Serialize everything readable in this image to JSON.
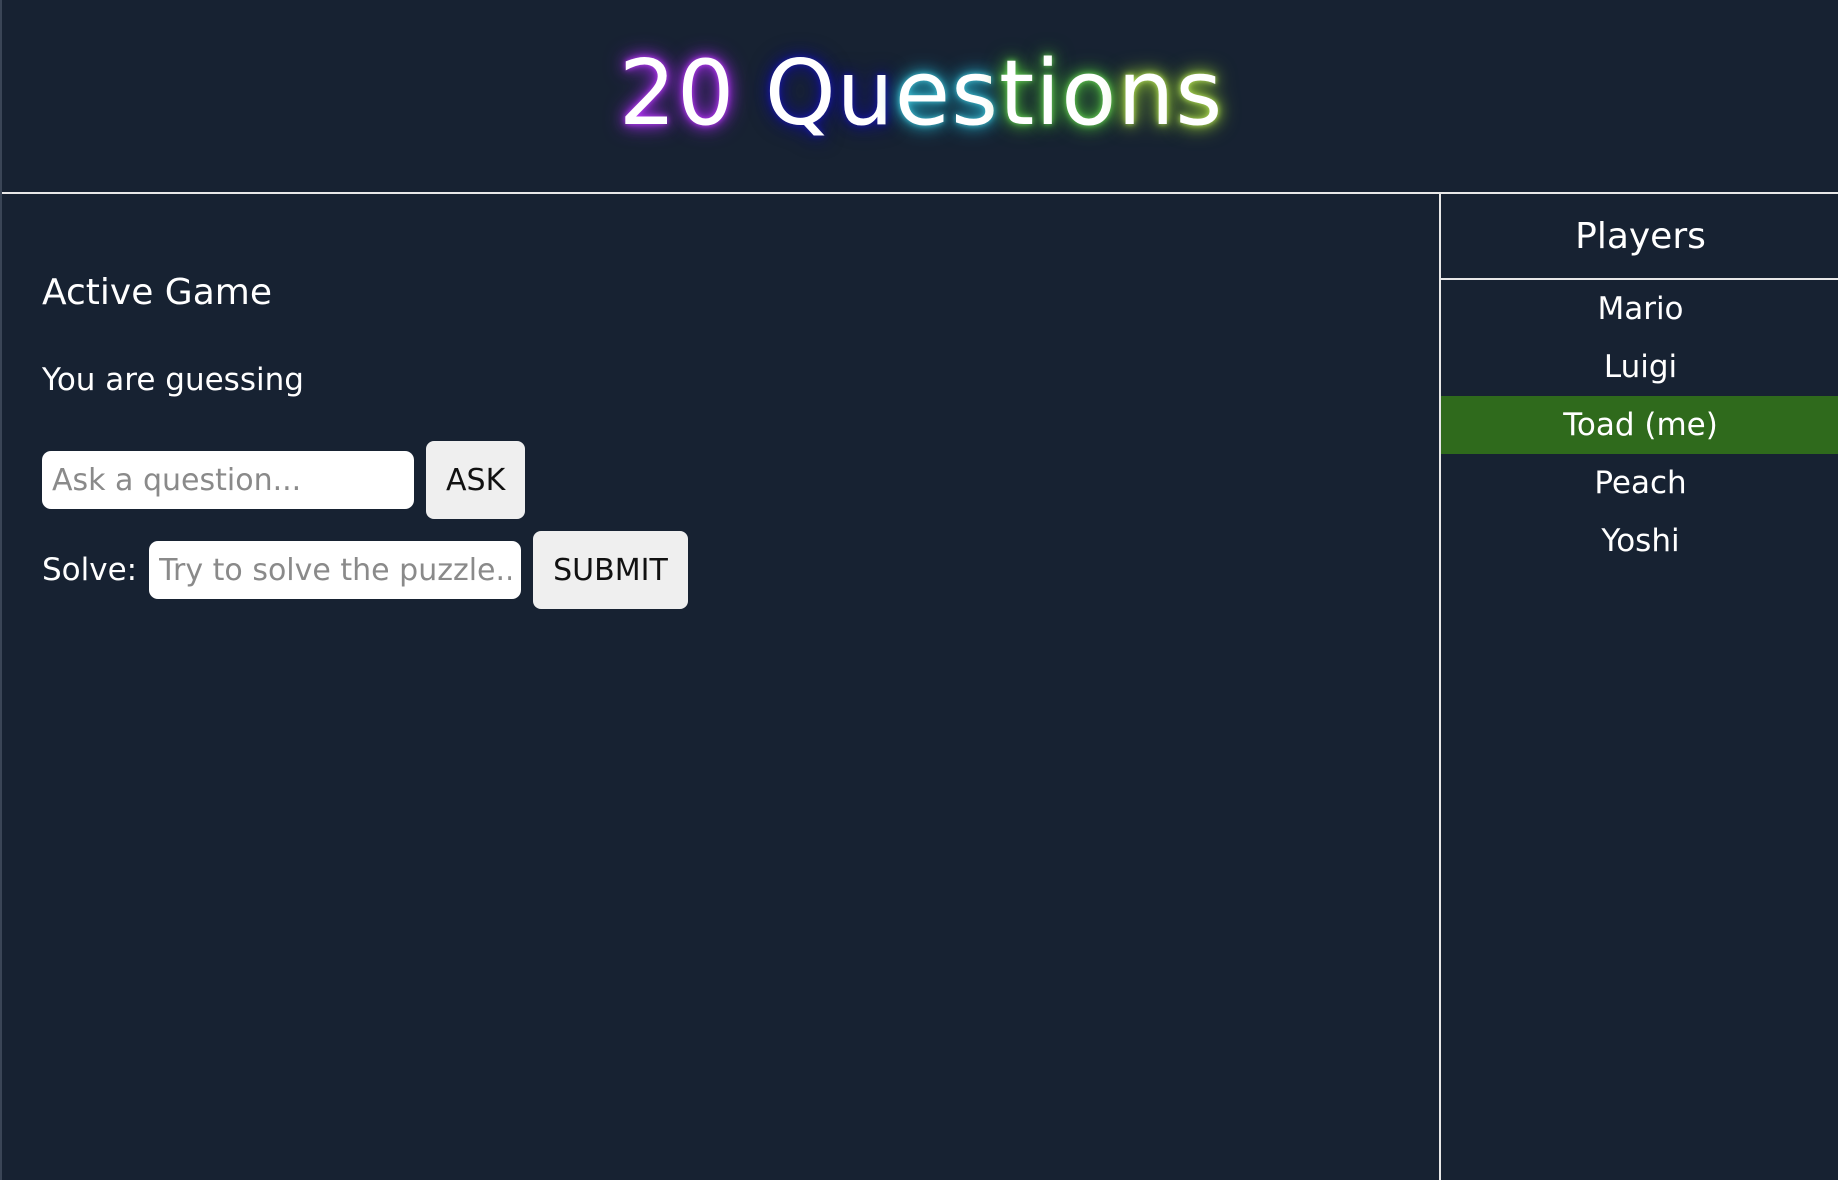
{
  "header": {
    "title_parts": [
      "20",
      "Qu",
      "es",
      "tio",
      "ns"
    ]
  },
  "main": {
    "heading": "Active Game",
    "status": "You are guessing",
    "ask": {
      "placeholder": "Ask a question...",
      "value": "",
      "button_label": "ASK"
    },
    "solve": {
      "label": "Solve:",
      "placeholder": "Try to solve the puzzle...",
      "value": "",
      "button_label": "SUBMIT"
    }
  },
  "sidebar": {
    "title": "Players",
    "players": [
      {
        "name": "Mario",
        "current": false
      },
      {
        "name": "Luigi",
        "current": false
      },
      {
        "name": "Toad (me)",
        "current": true
      },
      {
        "name": "Peach",
        "current": false
      },
      {
        "name": "Yoshi",
        "current": false
      }
    ]
  },
  "colors": {
    "background": "#172232",
    "current_player_highlight": "#2f6a1c",
    "divider": "#e8e8e8",
    "button_bg": "#efefef"
  }
}
